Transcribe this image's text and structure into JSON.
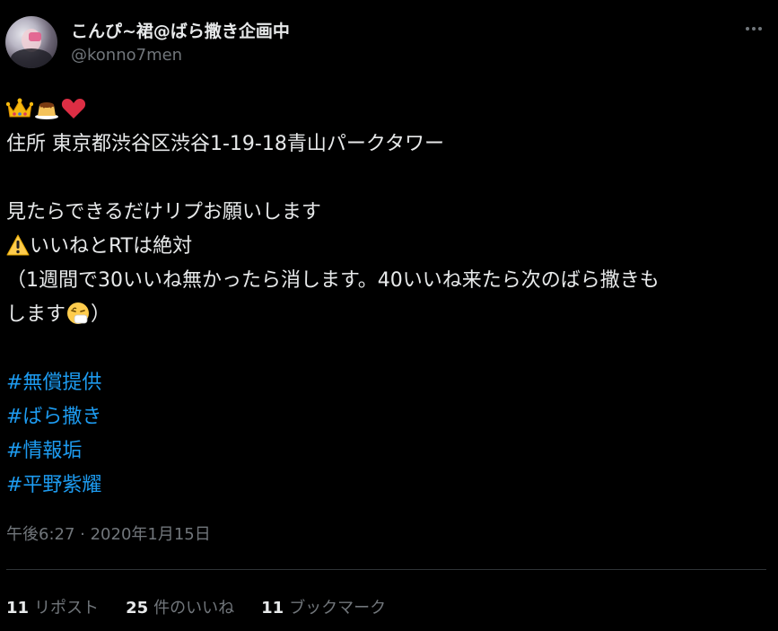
{
  "author": {
    "display_name": "こんぴ~裙@ばら撒き企画中",
    "handle": "@konno7men"
  },
  "icons": {
    "more": "more-dots-icon",
    "crown": "crown-emoji",
    "pudding": "pudding-emoji",
    "heart": "red-heart-emoji",
    "warning": "warning-emoji",
    "sneeze": "sneezing-face-emoji"
  },
  "body": {
    "address": "住所 東京都渋谷区渋谷1-19-18青山パークタワー",
    "request": "見たらできるだけリプお願いします",
    "rule": "いいねとRTは絶対",
    "note_line1": "（1週間で30いいね無かったら消します。40いいね来たら次のばら撒きも",
    "note_line2_a": "します",
    "note_line2_b": "）"
  },
  "hashtags": [
    "#無償提供",
    "#ばら撒き",
    "#情報垢",
    "#平野紫耀"
  ],
  "timestamp": "午後6:27 · 2020年1月15日",
  "stats": [
    {
      "count": "11",
      "label": "リポスト"
    },
    {
      "count": "25",
      "label": "件のいいね"
    },
    {
      "count": "11",
      "label": "ブックマーク"
    }
  ],
  "colors": {
    "background": "#000000",
    "text": "#e7e9ea",
    "secondary": "#71767b",
    "link": "#1d9bf0",
    "divider": "#2f3336"
  }
}
